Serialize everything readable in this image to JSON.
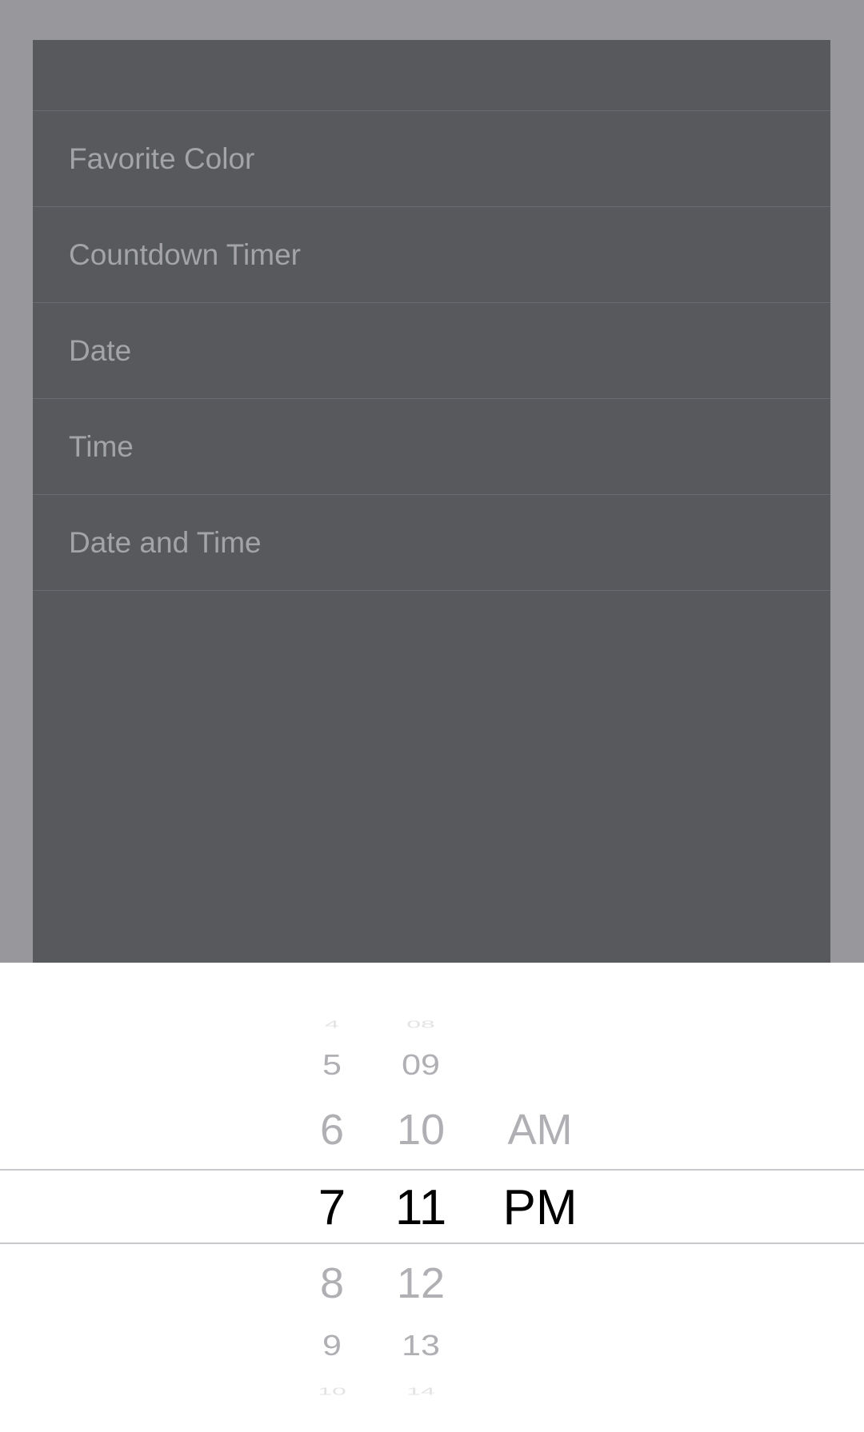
{
  "menu": {
    "items": [
      {
        "label": "Favorite Color"
      },
      {
        "label": "Countdown Timer"
      },
      {
        "label": "Date"
      },
      {
        "label": "Time"
      },
      {
        "label": "Date and Time"
      }
    ]
  },
  "picker": {
    "hours": [
      "4",
      "5",
      "6",
      "7",
      "8",
      "9",
      "10"
    ],
    "minutes": [
      "08",
      "09",
      "10",
      "11",
      "12",
      "13",
      "14"
    ],
    "ampm": [
      "AM",
      "PM"
    ],
    "selected": {
      "hour": "7",
      "minute": "11",
      "ampm": "PM"
    }
  },
  "colors": {
    "dim_overlay": "#98979c",
    "panel": "#58595d",
    "menu_text": "#a3a4a8",
    "wheel_text": "#b0b0b4",
    "selected_text": "#000000"
  }
}
